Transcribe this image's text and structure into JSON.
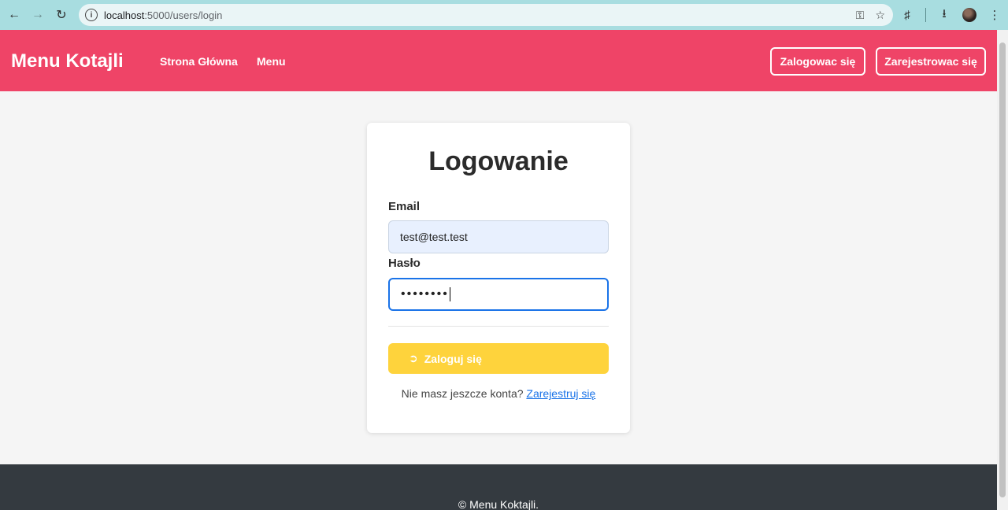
{
  "browser": {
    "url_host": "localhost",
    "url_path": ":5000/users/login"
  },
  "header": {
    "brand": "Menu Kotajli",
    "nav": [
      "Strona Główna",
      "Menu"
    ],
    "login_label": "Zalogowac się",
    "register_label": "Zarejestrowac się"
  },
  "login": {
    "title": "Logowanie",
    "email_label": "Email",
    "email_value": "test@test.test",
    "password_label": "Hasło",
    "password_value": "••••••••",
    "submit_label": "Zaloguj się",
    "signup_prompt": "Nie masz jeszcze konta?",
    "signup_link": "Zarejestruj się"
  },
  "footer": {
    "text": "© Menu Koktajli."
  },
  "colors": {
    "header": "#ef4467",
    "submit": "#fed33c",
    "footer": "#343a40"
  }
}
